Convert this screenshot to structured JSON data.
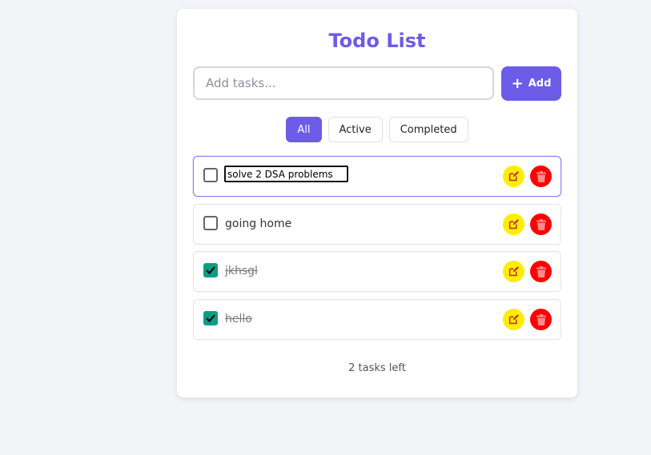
{
  "app": {
    "title": "Todo List",
    "accent_color": "#6c5ce7"
  },
  "add_form": {
    "placeholder": "Add tasks...",
    "value": "",
    "button_label": "Add",
    "button_icon": "plus-icon"
  },
  "filters": [
    {
      "label": "All",
      "active": true
    },
    {
      "label": "Active",
      "active": false
    },
    {
      "label": "Completed",
      "active": false
    }
  ],
  "todos": [
    {
      "text": "solve 2 DSA problems",
      "completed": false,
      "editing": true
    },
    {
      "text": "going home",
      "completed": false,
      "editing": false
    },
    {
      "text": "jkhsgl",
      "completed": true,
      "editing": false
    },
    {
      "text": "hello",
      "completed": true,
      "editing": false
    }
  ],
  "icons": {
    "edit": "edit-icon",
    "delete": "trash-icon",
    "check": "check-icon"
  },
  "colors": {
    "edit_button": "#ffee00",
    "delete_button": "#ff0000",
    "checkbox_checked": "#0f9d82"
  },
  "footer": {
    "tasks_left": "2 tasks left"
  }
}
